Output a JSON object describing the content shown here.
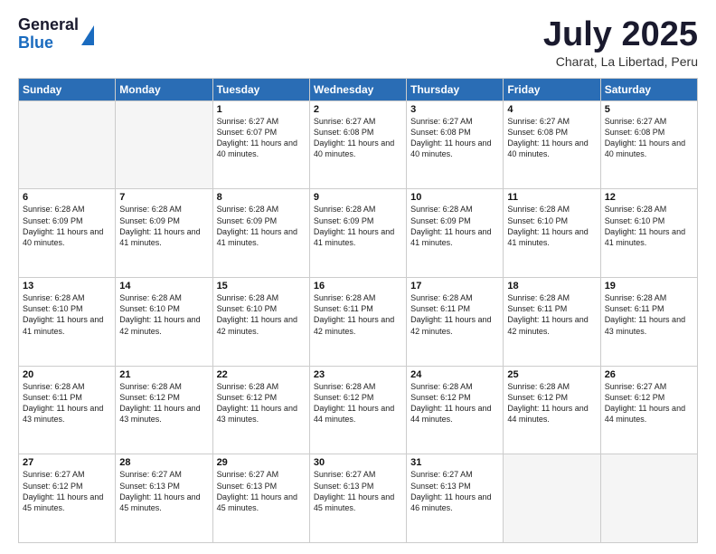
{
  "header": {
    "logo_general": "General",
    "logo_blue": "Blue",
    "month_title": "July 2025",
    "subtitle": "Charat, La Libertad, Peru"
  },
  "weekdays": [
    "Sunday",
    "Monday",
    "Tuesday",
    "Wednesday",
    "Thursday",
    "Friday",
    "Saturday"
  ],
  "weeks": [
    [
      {
        "day": "",
        "info": ""
      },
      {
        "day": "",
        "info": ""
      },
      {
        "day": "1",
        "info": "Sunrise: 6:27 AM\nSunset: 6:07 PM\nDaylight: 11 hours and 40 minutes."
      },
      {
        "day": "2",
        "info": "Sunrise: 6:27 AM\nSunset: 6:08 PM\nDaylight: 11 hours and 40 minutes."
      },
      {
        "day": "3",
        "info": "Sunrise: 6:27 AM\nSunset: 6:08 PM\nDaylight: 11 hours and 40 minutes."
      },
      {
        "day": "4",
        "info": "Sunrise: 6:27 AM\nSunset: 6:08 PM\nDaylight: 11 hours and 40 minutes."
      },
      {
        "day": "5",
        "info": "Sunrise: 6:27 AM\nSunset: 6:08 PM\nDaylight: 11 hours and 40 minutes."
      }
    ],
    [
      {
        "day": "6",
        "info": "Sunrise: 6:28 AM\nSunset: 6:09 PM\nDaylight: 11 hours and 40 minutes."
      },
      {
        "day": "7",
        "info": "Sunrise: 6:28 AM\nSunset: 6:09 PM\nDaylight: 11 hours and 41 minutes."
      },
      {
        "day": "8",
        "info": "Sunrise: 6:28 AM\nSunset: 6:09 PM\nDaylight: 11 hours and 41 minutes."
      },
      {
        "day": "9",
        "info": "Sunrise: 6:28 AM\nSunset: 6:09 PM\nDaylight: 11 hours and 41 minutes."
      },
      {
        "day": "10",
        "info": "Sunrise: 6:28 AM\nSunset: 6:09 PM\nDaylight: 11 hours and 41 minutes."
      },
      {
        "day": "11",
        "info": "Sunrise: 6:28 AM\nSunset: 6:10 PM\nDaylight: 11 hours and 41 minutes."
      },
      {
        "day": "12",
        "info": "Sunrise: 6:28 AM\nSunset: 6:10 PM\nDaylight: 11 hours and 41 minutes."
      }
    ],
    [
      {
        "day": "13",
        "info": "Sunrise: 6:28 AM\nSunset: 6:10 PM\nDaylight: 11 hours and 41 minutes."
      },
      {
        "day": "14",
        "info": "Sunrise: 6:28 AM\nSunset: 6:10 PM\nDaylight: 11 hours and 42 minutes."
      },
      {
        "day": "15",
        "info": "Sunrise: 6:28 AM\nSunset: 6:10 PM\nDaylight: 11 hours and 42 minutes."
      },
      {
        "day": "16",
        "info": "Sunrise: 6:28 AM\nSunset: 6:11 PM\nDaylight: 11 hours and 42 minutes."
      },
      {
        "day": "17",
        "info": "Sunrise: 6:28 AM\nSunset: 6:11 PM\nDaylight: 11 hours and 42 minutes."
      },
      {
        "day": "18",
        "info": "Sunrise: 6:28 AM\nSunset: 6:11 PM\nDaylight: 11 hours and 42 minutes."
      },
      {
        "day": "19",
        "info": "Sunrise: 6:28 AM\nSunset: 6:11 PM\nDaylight: 11 hours and 43 minutes."
      }
    ],
    [
      {
        "day": "20",
        "info": "Sunrise: 6:28 AM\nSunset: 6:11 PM\nDaylight: 11 hours and 43 minutes."
      },
      {
        "day": "21",
        "info": "Sunrise: 6:28 AM\nSunset: 6:12 PM\nDaylight: 11 hours and 43 minutes."
      },
      {
        "day": "22",
        "info": "Sunrise: 6:28 AM\nSunset: 6:12 PM\nDaylight: 11 hours and 43 minutes."
      },
      {
        "day": "23",
        "info": "Sunrise: 6:28 AM\nSunset: 6:12 PM\nDaylight: 11 hours and 44 minutes."
      },
      {
        "day": "24",
        "info": "Sunrise: 6:28 AM\nSunset: 6:12 PM\nDaylight: 11 hours and 44 minutes."
      },
      {
        "day": "25",
        "info": "Sunrise: 6:28 AM\nSunset: 6:12 PM\nDaylight: 11 hours and 44 minutes."
      },
      {
        "day": "26",
        "info": "Sunrise: 6:27 AM\nSunset: 6:12 PM\nDaylight: 11 hours and 44 minutes."
      }
    ],
    [
      {
        "day": "27",
        "info": "Sunrise: 6:27 AM\nSunset: 6:12 PM\nDaylight: 11 hours and 45 minutes."
      },
      {
        "day": "28",
        "info": "Sunrise: 6:27 AM\nSunset: 6:13 PM\nDaylight: 11 hours and 45 minutes."
      },
      {
        "day": "29",
        "info": "Sunrise: 6:27 AM\nSunset: 6:13 PM\nDaylight: 11 hours and 45 minutes."
      },
      {
        "day": "30",
        "info": "Sunrise: 6:27 AM\nSunset: 6:13 PM\nDaylight: 11 hours and 45 minutes."
      },
      {
        "day": "31",
        "info": "Sunrise: 6:27 AM\nSunset: 6:13 PM\nDaylight: 11 hours and 46 minutes."
      },
      {
        "day": "",
        "info": ""
      },
      {
        "day": "",
        "info": ""
      }
    ]
  ]
}
